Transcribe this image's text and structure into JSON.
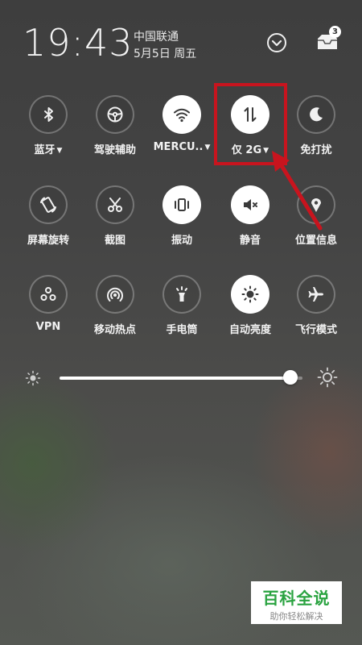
{
  "status": {
    "time": "19:43",
    "carrier": "中国联通",
    "date": "5月5日 周五",
    "notification_count": "3"
  },
  "tiles": [
    {
      "label": "蓝牙",
      "icon": "bluetooth-icon",
      "active": false,
      "dropdown": true
    },
    {
      "label": "驾驶辅助",
      "icon": "steering-wheel-icon",
      "active": false,
      "dropdown": false
    },
    {
      "label": "MERCU..",
      "icon": "wifi-icon",
      "active": true,
      "dropdown": true
    },
    {
      "label": "仅 2G",
      "icon": "mobile-data-icon",
      "active": true,
      "dropdown": true
    },
    {
      "label": "免打扰",
      "icon": "moon-icon",
      "active": false,
      "dropdown": false
    },
    {
      "label": "屏幕旋转",
      "icon": "screen-rotation-icon",
      "active": false,
      "dropdown": false
    },
    {
      "label": "截图",
      "icon": "scissors-icon",
      "active": false,
      "dropdown": false
    },
    {
      "label": "振动",
      "icon": "vibrate-icon",
      "active": true,
      "dropdown": false
    },
    {
      "label": "静音",
      "icon": "mute-icon",
      "active": true,
      "dropdown": false
    },
    {
      "label": "位置信息",
      "icon": "location-icon",
      "active": false,
      "dropdown": false
    },
    {
      "label": "VPN",
      "icon": "vpn-icon",
      "active": false,
      "dropdown": false
    },
    {
      "label": "移动热点",
      "icon": "hotspot-icon",
      "active": false,
      "dropdown": false
    },
    {
      "label": "手电筒",
      "icon": "flashlight-icon",
      "active": false,
      "dropdown": false
    },
    {
      "label": "自动亮度",
      "icon": "auto-brightness-icon",
      "active": true,
      "dropdown": false
    },
    {
      "label": "飞行模式",
      "icon": "airplane-icon",
      "active": false,
      "dropdown": false
    }
  ],
  "brightness": {
    "level": 0.95
  },
  "watermark": {
    "title": "百科全说",
    "subtitle": "助你轻松解决"
  },
  "colors": {
    "highlight": "#c8141e",
    "watermark_green": "#2aa340"
  }
}
